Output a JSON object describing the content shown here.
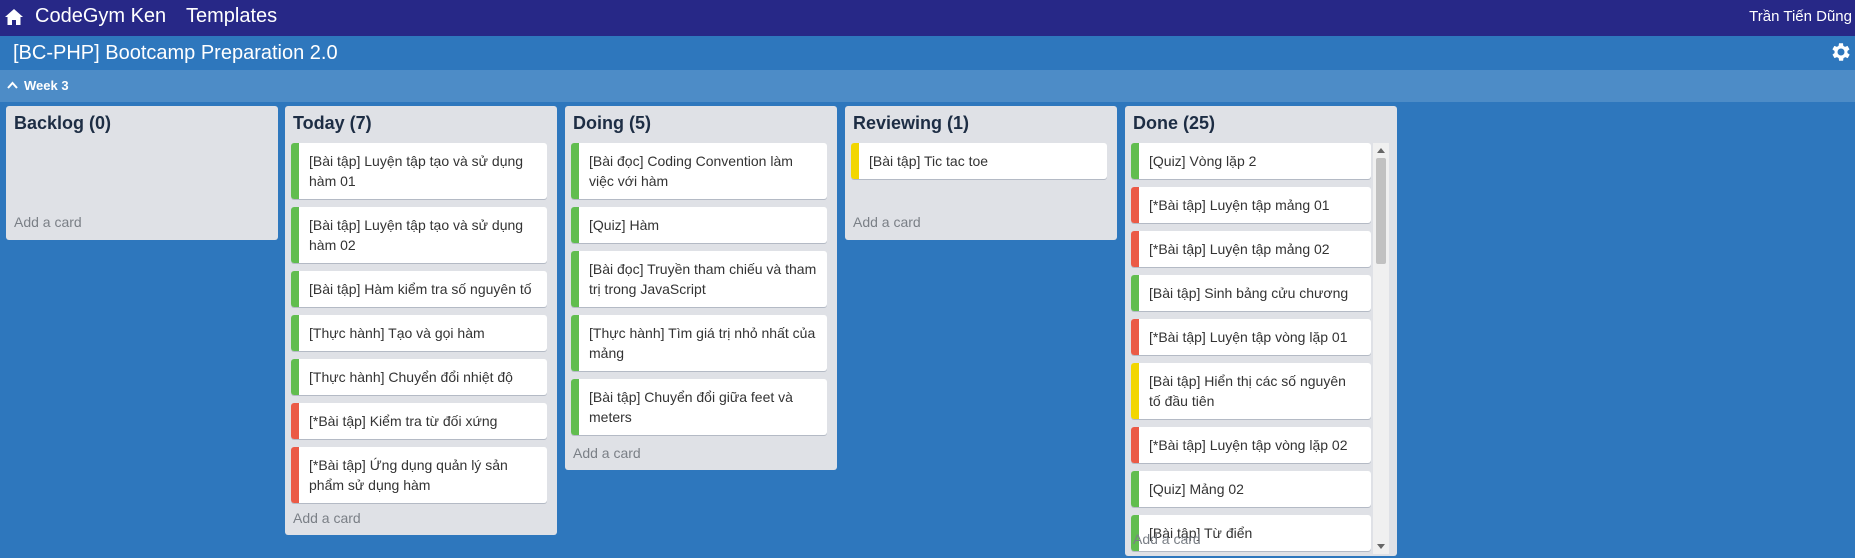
{
  "topnav": {
    "brand": "CodeGym Ken",
    "templates": "Templates",
    "user": "Trần Tiến Dũng"
  },
  "board": {
    "title": "[BC-PHP] Bootcamp Preparation 2.0"
  },
  "week": {
    "label": "Week 3"
  },
  "colors": {
    "green": "#61bd4f",
    "red": "#eb5a46",
    "yellow": "#f2d600"
  },
  "lists": [
    {
      "title": "Backlog (0)",
      "add_card": "Add a card",
      "cards": []
    },
    {
      "title": "Today (7)",
      "add_card": "Add a card",
      "cards": [
        {
          "text": "[Bài tập] Luyện tập tạo và sử dụng hàm 01",
          "label": "green"
        },
        {
          "text": "[Bài tập] Luyện tập tạo và sử dụng hàm 02",
          "label": "green"
        },
        {
          "text": "[Bài tập] Hàm kiểm tra số nguyên tố",
          "label": "green"
        },
        {
          "text": "[Thực hành] Tạo và gọi hàm",
          "label": "green"
        },
        {
          "text": "[Thực hành] Chuyển đổi nhiệt độ",
          "label": "green"
        },
        {
          "text": "[*Bài tập] Kiểm tra từ đối xứng",
          "label": "red"
        },
        {
          "text": "[*Bài tập] Ứng dụng quản lý sản phẩm sử dụng hàm",
          "label": "red"
        }
      ]
    },
    {
      "title": "Doing (5)",
      "add_card": "Add a card",
      "cards": [
        {
          "text": "[Bài đọc] Coding Convention làm việc với hàm",
          "label": "green"
        },
        {
          "text": "[Quiz] Hàm",
          "label": "green"
        },
        {
          "text": "[Bài đọc] Truyền tham chiếu và tham trị trong JavaScript",
          "label": "green"
        },
        {
          "text": "[Thực hành] Tìm giá trị nhỏ nhất của mảng",
          "label": "green"
        },
        {
          "text": "[Bài tập] Chuyển đổi giữa feet và meters",
          "label": "green"
        }
      ]
    },
    {
      "title": "Reviewing (1)",
      "add_card": "Add a card",
      "cards": [
        {
          "text": "[Bài tập] Tic tac toe",
          "label": "yellow"
        }
      ]
    },
    {
      "title": "Done (25)",
      "add_card": "Add a card",
      "cards": [
        {
          "text": "[Quiz] Vòng lặp 2",
          "label": "green"
        },
        {
          "text": "[*Bài tập] Luyện tập mảng 01",
          "label": "red"
        },
        {
          "text": "[*Bài tập] Luyện tập mảng 02",
          "label": "red"
        },
        {
          "text": "[Bài tập] Sinh bảng cửu chương",
          "label": "green"
        },
        {
          "text": "[*Bài tập] Luyện tập vòng lặp 01",
          "label": "red"
        },
        {
          "text": "[Bài tập] Hiển thị các số nguyên tố đầu tiên",
          "label": "yellow"
        },
        {
          "text": "[*Bài tập] Luyện tập vòng lặp 02",
          "label": "red"
        },
        {
          "text": "[Quiz] Mảng 02",
          "label": "green"
        },
        {
          "text": "[Bài tập] Từ điển",
          "label": "green"
        }
      ]
    }
  ]
}
